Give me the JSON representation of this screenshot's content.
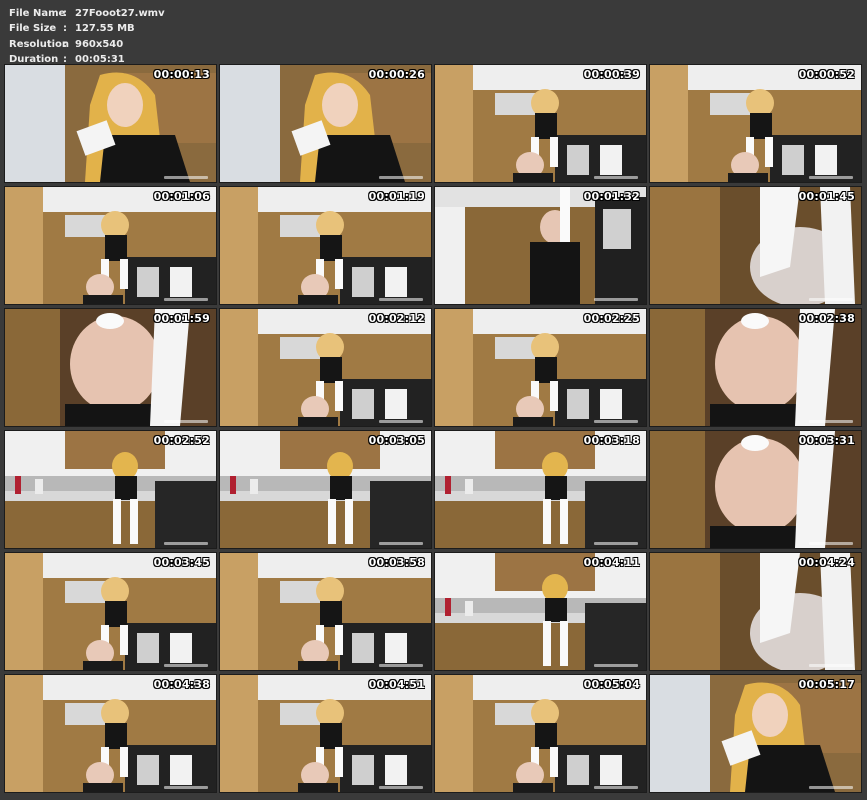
{
  "file_info": {
    "name_label": "File Name",
    "name_value": "27Fooot27.wmv",
    "size_label": "File Size",
    "size_value": "127.55 MB",
    "resolution_label": "Resolution",
    "resolution_value": "960x540",
    "duration_label": "Duration",
    "duration_value": "00:05:31",
    "separator": ":"
  },
  "colors": {
    "background": "#3a3a3a",
    "header_text": "#ececec",
    "timestamp_text": "#ffffff",
    "cabinet_wood": "#9a7440",
    "wall": "#e6e6e8"
  },
  "thumbnails": [
    {
      "time": "00:00:13",
      "scene": "closeup-girl"
    },
    {
      "time": "00:00:26",
      "scene": "closeup-girl"
    },
    {
      "time": "00:00:39",
      "scene": "kitchen-counter"
    },
    {
      "time": "00:00:52",
      "scene": "kitchen-counter"
    },
    {
      "time": "00:01:06",
      "scene": "kitchen-counter"
    },
    {
      "time": "00:01:19",
      "scene": "kitchen-counter"
    },
    {
      "time": "00:01:32",
      "scene": "kitchen-floor"
    },
    {
      "time": "00:01:45",
      "scene": "sock-closeup"
    },
    {
      "time": "00:01:59",
      "scene": "face-closeup"
    },
    {
      "time": "00:02:12",
      "scene": "kitchen-counter"
    },
    {
      "time": "00:02:25",
      "scene": "kitchen-counter"
    },
    {
      "time": "00:02:38",
      "scene": "face-closeup"
    },
    {
      "time": "00:02:52",
      "scene": "kitchen-wide"
    },
    {
      "time": "00:03:05",
      "scene": "kitchen-wide"
    },
    {
      "time": "00:03:18",
      "scene": "kitchen-wide"
    },
    {
      "time": "00:03:31",
      "scene": "face-closeup"
    },
    {
      "time": "00:03:45",
      "scene": "kitchen-counter"
    },
    {
      "time": "00:03:58",
      "scene": "kitchen-counter"
    },
    {
      "time": "00:04:11",
      "scene": "kitchen-wide"
    },
    {
      "time": "00:04:24",
      "scene": "sock-closeup"
    },
    {
      "time": "00:04:38",
      "scene": "kitchen-counter"
    },
    {
      "time": "00:04:51",
      "scene": "kitchen-counter"
    },
    {
      "time": "00:05:04",
      "scene": "kitchen-counter"
    },
    {
      "time": "00:05:17",
      "scene": "closeup-girl"
    }
  ]
}
